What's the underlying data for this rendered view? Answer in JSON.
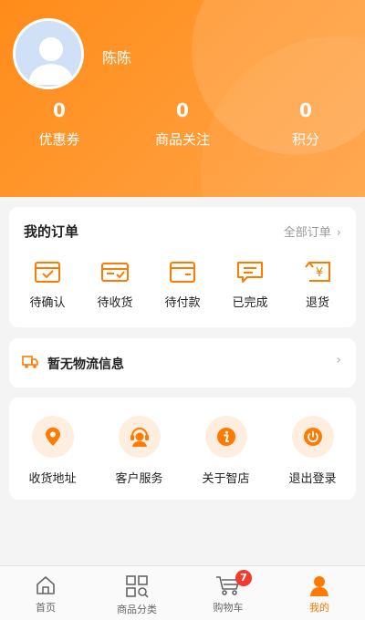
{
  "profile": {
    "username": "陈陈"
  },
  "stats": [
    {
      "value": "0",
      "label": "优惠券"
    },
    {
      "value": "0",
      "label": "商品关注"
    },
    {
      "value": "0",
      "label": "积分"
    }
  ],
  "orders": {
    "title": "我的订单",
    "all_label": "全部订单",
    "items": [
      {
        "label": "待确认",
        "icon": "inbox-check-icon"
      },
      {
        "label": "待收货",
        "icon": "package-check-icon"
      },
      {
        "label": "待付款",
        "icon": "wallet-icon"
      },
      {
        "label": "已完成",
        "icon": "message-done-icon"
      },
      {
        "label": "退货",
        "icon": "refund-icon"
      }
    ]
  },
  "logistics": {
    "text": "暂无物流信息"
  },
  "services": [
    {
      "label": "收货地址",
      "icon": "location-pin-icon"
    },
    {
      "label": "客户服务",
      "icon": "customer-service-icon"
    },
    {
      "label": "关于智店",
      "icon": "info-icon"
    },
    {
      "label": "退出登录",
      "icon": "power-icon"
    }
  ],
  "tabbar": [
    {
      "label": "首页",
      "icon": "home-icon"
    },
    {
      "label": "商品分类",
      "icon": "category-icon"
    },
    {
      "label": "购物车",
      "icon": "cart-icon",
      "badge": "7"
    },
    {
      "label": "我的",
      "icon": "user-icon",
      "active": true
    }
  ],
  "colors": {
    "accent": "#ff7a00",
    "badge": "#f23b2f"
  }
}
